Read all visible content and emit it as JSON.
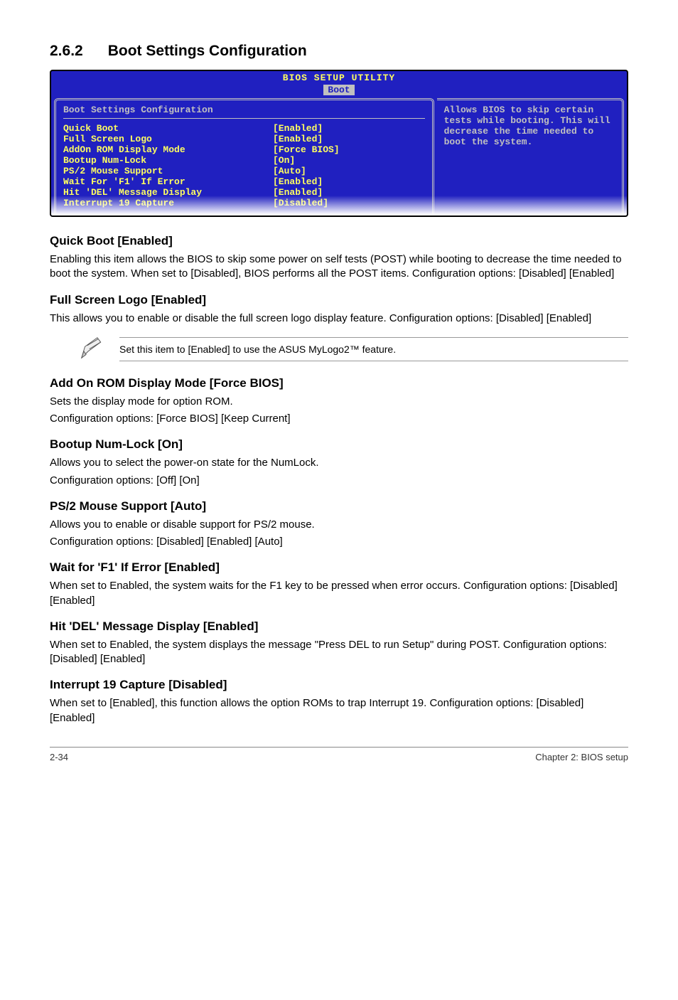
{
  "section_number": "2.6.2",
  "section_title": "Boot Settings Configuration",
  "bios": {
    "header1": "BIOS SETUP UTILITY",
    "header2": "Boot",
    "panel_title": "Boot Settings Configuration",
    "rows": [
      {
        "label": "Quick Boot",
        "value": "[Enabled]"
      },
      {
        "label": "Full Screen Logo",
        "value": "[Enabled]"
      },
      {
        "label": "AddOn ROM Display Mode",
        "value": "[Force BIOS]"
      },
      {
        "label": "Bootup Num-Lock",
        "value": "[On]"
      },
      {
        "label": "PS/2 Mouse Support",
        "value": "[Auto]"
      },
      {
        "label": "Wait For 'F1' If Error",
        "value": "[Enabled]"
      },
      {
        "label": "Hit 'DEL' Message Display",
        "value": "[Enabled]"
      },
      {
        "label": "Interrupt 19 Capture",
        "value": "[Disabled]"
      }
    ],
    "help_text": "Allows BIOS to skip certain tests while booting. This will decrease the time needed to boot the system."
  },
  "sections": [
    {
      "heading": "Quick Boot [Enabled]",
      "paras": [
        "Enabling this item allows the BIOS to skip some power on self tests (POST) while booting to decrease the time needed to boot the system. When set to [Disabled], BIOS performs all the POST items. Configuration options: [Disabled] [Enabled]"
      ]
    },
    {
      "heading": "Full Screen Logo [Enabled]",
      "paras": [
        "This allows you to enable or disable the full screen logo display feature. Configuration options: [Disabled] [Enabled]"
      ]
    }
  ],
  "note_text": "Set this item to [Enabled] to use the ASUS MyLogo2™ feature.",
  "sections2": [
    {
      "heading": "Add On ROM Display Mode [Force BIOS]",
      "paras": [
        "Sets the display mode for option ROM.",
        "Configuration options: [Force BIOS] [Keep Current]"
      ]
    },
    {
      "heading": "Bootup Num-Lock [On]",
      "paras": [
        "Allows you to select the power-on state for the NumLock.",
        "Configuration options: [Off] [On]"
      ]
    },
    {
      "heading": "PS/2 Mouse Support [Auto]",
      "paras": [
        "Allows you to enable or disable support for PS/2 mouse.",
        "Configuration options: [Disabled] [Enabled] [Auto]"
      ]
    },
    {
      "heading": "Wait for 'F1' If Error [Enabled]",
      "paras": [
        "When set to Enabled, the system waits for the F1 key to be pressed when error occurs. Configuration options: [Disabled] [Enabled]"
      ]
    },
    {
      "heading": "Hit 'DEL' Message Display [Enabled]",
      "paras": [
        "When set to Enabled, the system displays the message \"Press DEL to run Setup\" during POST. Configuration options: [Disabled] [Enabled]"
      ]
    },
    {
      "heading": "Interrupt 19 Capture [Disabled]",
      "paras": [
        "When set to [Enabled], this function allows the option ROMs to trap Interrupt 19. Configuration options: [Disabled] [Enabled]"
      ]
    }
  ],
  "footer": {
    "left": "2-34",
    "right": "Chapter 2: BIOS setup"
  }
}
